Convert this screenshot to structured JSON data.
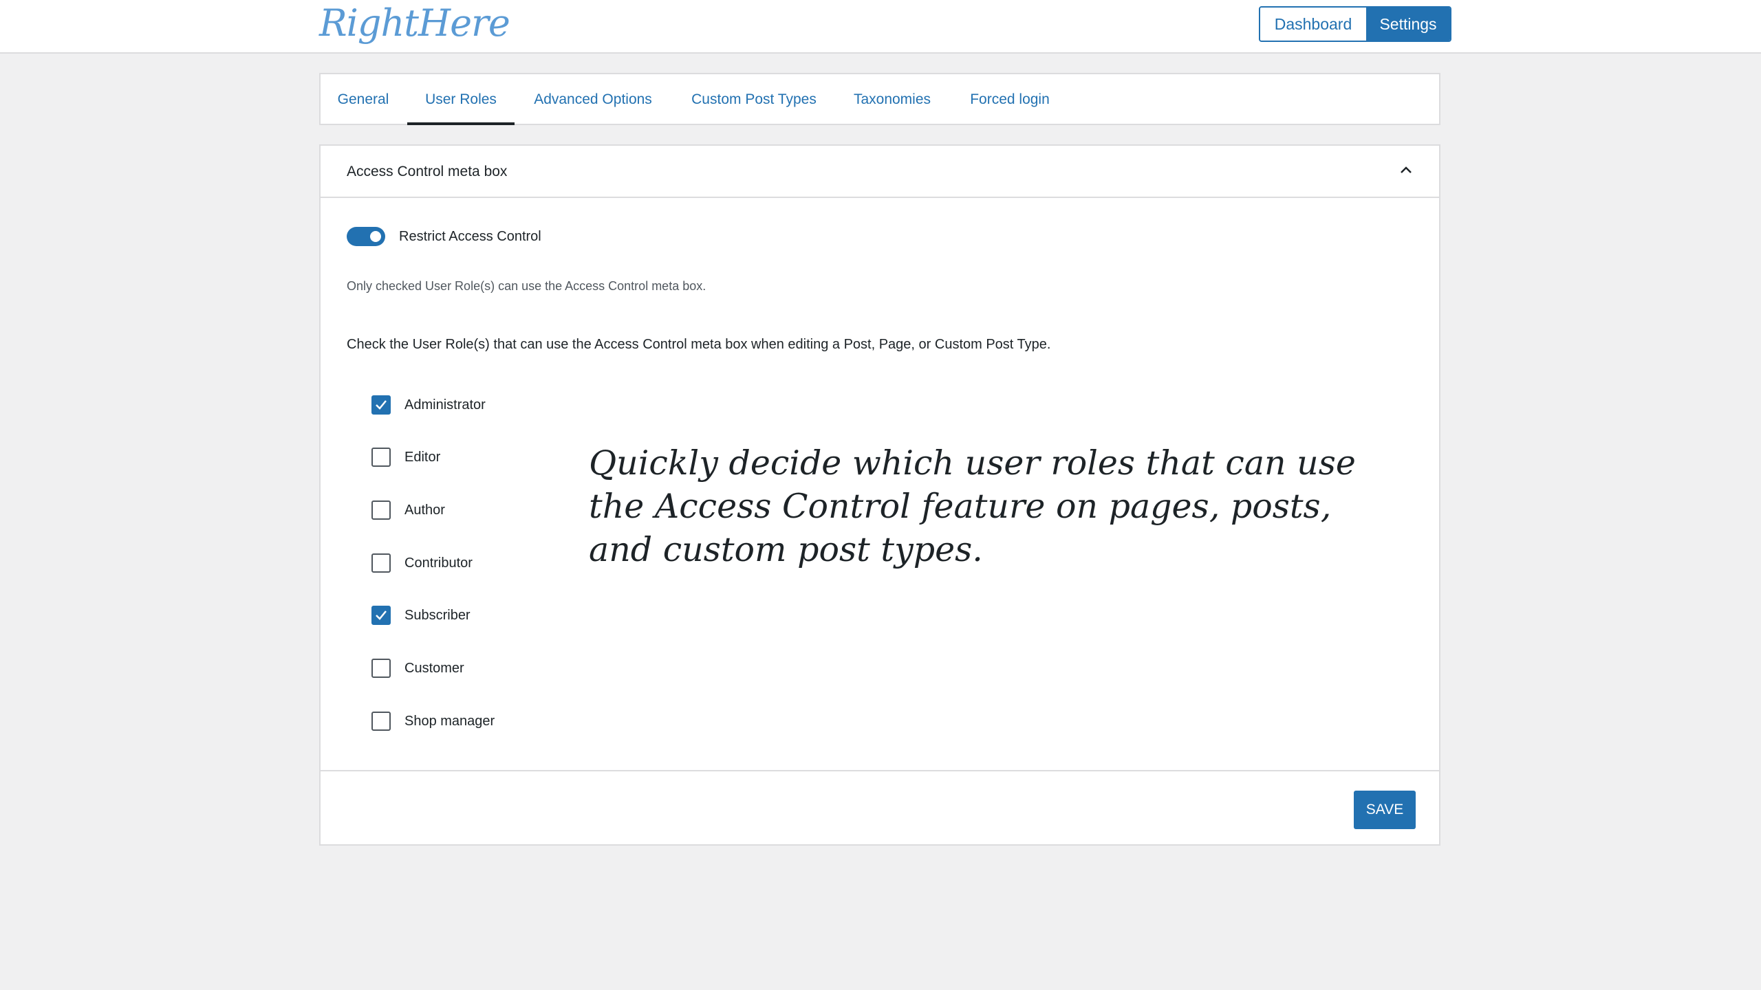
{
  "header": {
    "logo_text": "RightHere",
    "buttons": {
      "dashboard": "Dashboard",
      "settings": "Settings"
    }
  },
  "tabs": [
    {
      "label": "General"
    },
    {
      "label": "User Roles"
    },
    {
      "label": "Advanced Options"
    },
    {
      "label": "Custom Post Types"
    },
    {
      "label": "Taxonomies"
    },
    {
      "label": "Forced login"
    }
  ],
  "active_tab": "User Roles",
  "panel": {
    "title": "Access Control meta box",
    "toggle_label": "Restrict Access Control",
    "toggle_on": true,
    "hint": "Only checked User Role(s) can use the Access Control meta box.",
    "instruction": "Check the User Role(s) that can use the Access Control meta box when editing a Post, Page, or Custom Post Type.",
    "roles": [
      {
        "label": "Administrator",
        "checked": true
      },
      {
        "label": "Editor",
        "checked": false
      },
      {
        "label": "Author",
        "checked": false
      },
      {
        "label": "Contributor",
        "checked": false
      },
      {
        "label": "Subscriber",
        "checked": true
      },
      {
        "label": "Customer",
        "checked": false
      },
      {
        "label": "Shop manager",
        "checked": false
      }
    ],
    "save_label": "SAVE"
  },
  "annotation": "Quickly decide which user roles that can use the Access Control feature on pages, posts, and custom post types.",
  "colors": {
    "accent": "#2271b1",
    "background": "#f0f0f1",
    "logo": "#5b9bd5"
  }
}
